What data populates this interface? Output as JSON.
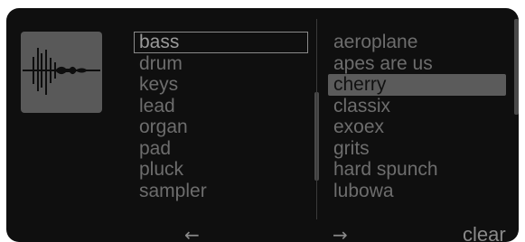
{
  "thumbnail": {
    "icon": "waveform-icon"
  },
  "categories": {
    "selected": "bass",
    "items": [
      "bass",
      "drum",
      "keys",
      "lead",
      "organ",
      "pad",
      "pluck",
      "sampler"
    ]
  },
  "presets": {
    "selected": "cherry",
    "items": [
      "aeroplane",
      "apes are us",
      "cherry",
      "classix",
      "exoex",
      "grits",
      "hard spunch",
      "lubowa"
    ]
  },
  "nav": {
    "prev_label": "←",
    "next_label": "→",
    "clear_label": "clear"
  }
}
